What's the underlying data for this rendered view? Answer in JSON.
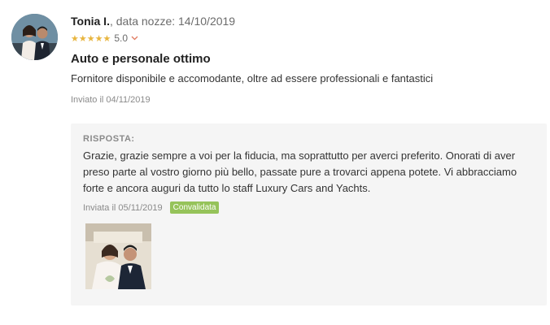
{
  "reviewer": {
    "name": "Tonia I.",
    "wedding_date": ", data nozze: 14/10/2019",
    "stars": "★★★★★",
    "rating": "5.0",
    "avatar_icon": "couple-photo-avatar"
  },
  "review": {
    "title": "Auto e personale ottimo",
    "body": "Fornitore disponibile e accomodante, oltre ad essere professionali e fantastici",
    "sent_date": "Inviato il 04/11/2019"
  },
  "reply": {
    "heading": "RISPOSTA:",
    "text": "Grazie, grazie sempre a voi per la fiducia, ma soprattutto per averci preferito. Onorati di aver preso parte al vostro giorno più bello, passate pure a trovarci appena potete. Vi abbracciamo forte e ancora auguri da tutto lo staff Luxury Cars and Yachts.",
    "sent_date": "Inviata il 05/11/2019",
    "badge": "Convalidata",
    "badge_color": "#96c35a"
  },
  "colors": {
    "star": "#e8b53e",
    "reply_background": "#f5f5f5"
  }
}
